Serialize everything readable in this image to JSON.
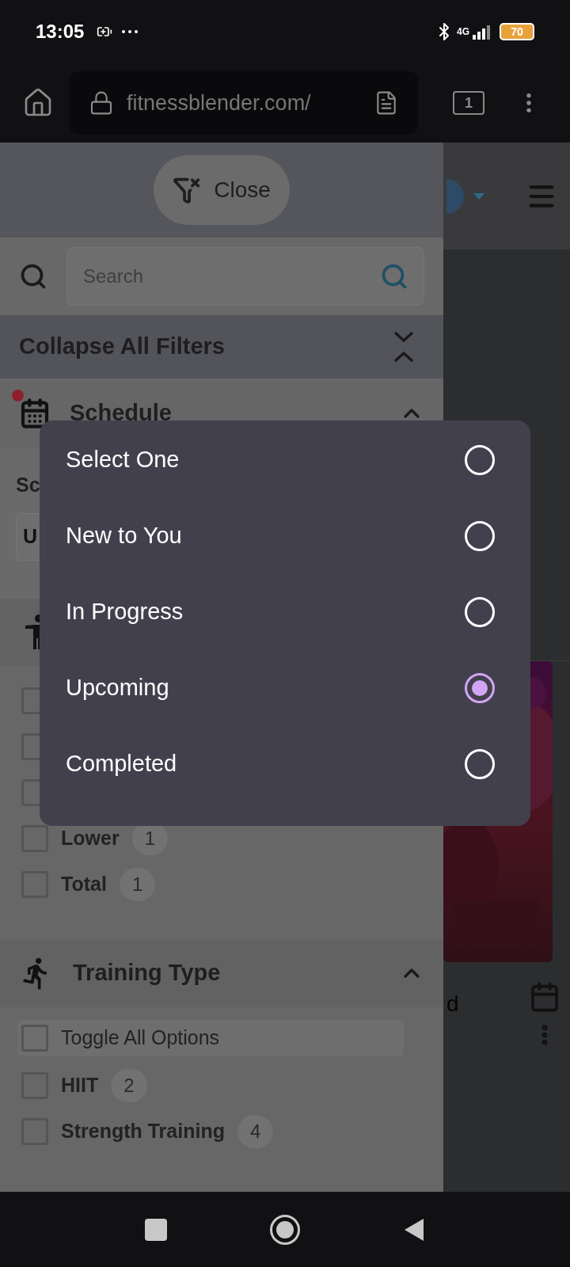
{
  "status_bar": {
    "time": "13:05",
    "network": "4G",
    "battery": "70"
  },
  "browser": {
    "url": "fitnessblender.com/",
    "tab_count": "1"
  },
  "filter_panel": {
    "close_button": "Close",
    "search": {
      "placeholder": "Search"
    },
    "collapse_all": "Collapse All Filters",
    "schedule": {
      "title": "Schedule",
      "expanded": true,
      "has_active_filter": true,
      "field_label": "Sc",
      "field_value": "U"
    },
    "body_focus": {
      "options": [
        {
          "checked": false
        },
        {
          "checked": false
        },
        {
          "checked": false
        },
        {
          "label": "Lower",
          "count": "1",
          "checked": false
        },
        {
          "label": "Total",
          "count": "1",
          "checked": false
        }
      ]
    },
    "training_type": {
      "title": "Training Type",
      "expanded": true,
      "toggle_all": {
        "label": "Toggle All Options",
        "checked": false
      },
      "options": [
        {
          "label": "HIIT",
          "count": "2",
          "checked": false
        },
        {
          "label": "Strength Training",
          "count": "4",
          "checked": false
        }
      ]
    }
  },
  "background_page": {
    "text_fragment": "d"
  },
  "dialog": {
    "options": [
      {
        "label": "Select One",
        "selected": false
      },
      {
        "label": "New to You",
        "selected": false
      },
      {
        "label": "In Progress",
        "selected": false
      },
      {
        "label": "Upcoming",
        "selected": true
      },
      {
        "label": "Completed",
        "selected": false
      }
    ]
  }
}
